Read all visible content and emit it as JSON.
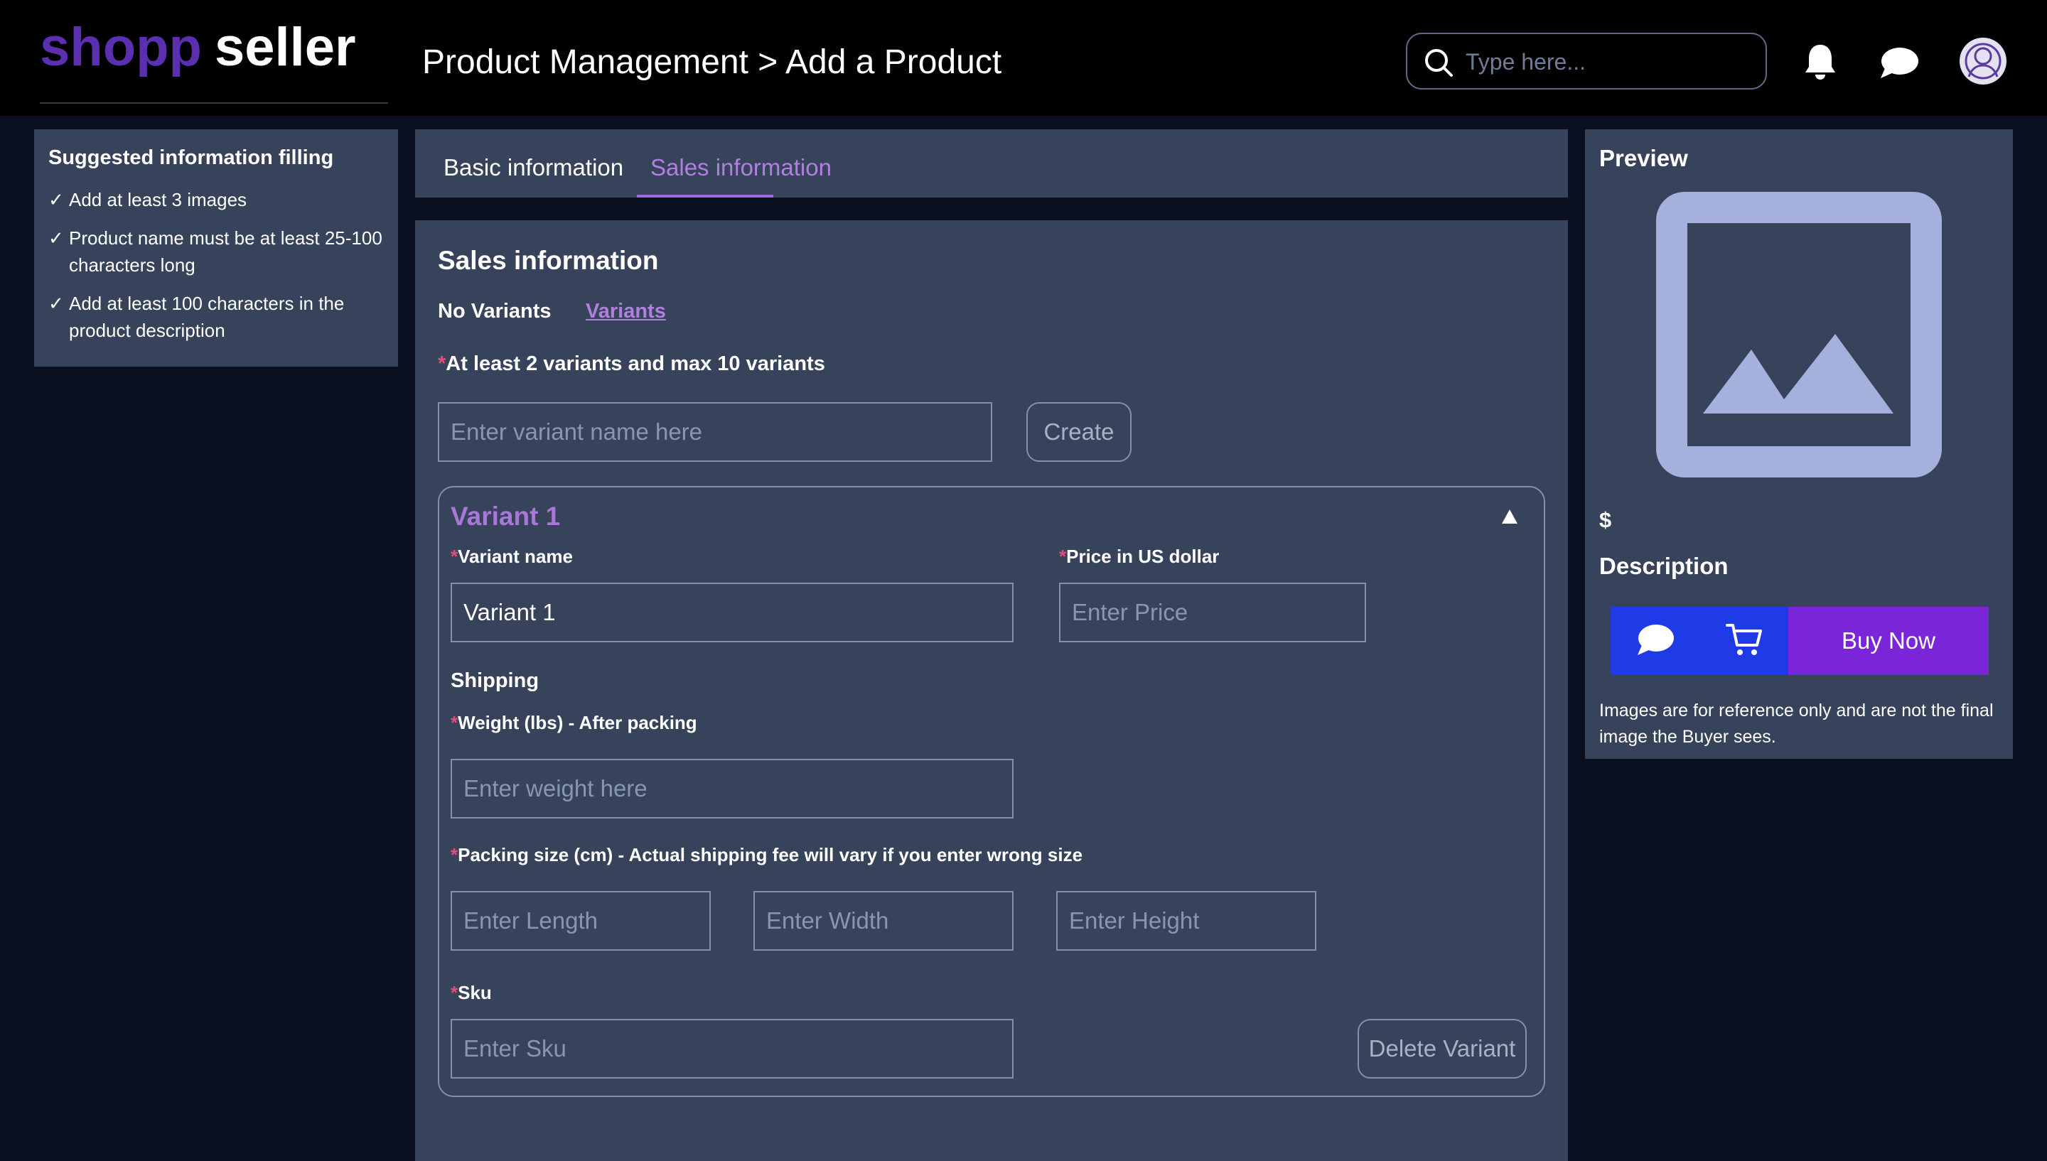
{
  "brand": {
    "part1": "shopp",
    "part2": "seller"
  },
  "header": {
    "title": "Product Management > Add a Product",
    "search_placeholder": "Type here..."
  },
  "suggestions": {
    "title": "Suggested information filling",
    "items": [
      "Add at least 3 images",
      "Product name must be at least 25-100 characters long",
      "Add at least 100 characters in the product description"
    ]
  },
  "tabs": [
    {
      "label": "Basic information",
      "active": false
    },
    {
      "label": "Sales information",
      "active": true
    }
  ],
  "sales": {
    "title": "Sales information",
    "no_variants_label": "No Variants",
    "variants_label": "Variants",
    "rule_note": "At least 2 variants and max 10 variants",
    "variant_name_placeholder": "Enter variant name here",
    "create_label": "Create"
  },
  "variant": {
    "title": "Variant 1",
    "name_label": "Variant name",
    "name_value": "Variant 1",
    "price_label": "Price in US dollar",
    "price_placeholder": "Enter Price",
    "shipping_label": "Shipping",
    "weight_label": "Weight (lbs) - After packing",
    "weight_placeholder": "Enter weight here",
    "packing_label": "Packing size (cm) - Actual shipping fee will vary if you enter wrong size",
    "length_placeholder": "Enter Length",
    "width_placeholder": "Enter Width",
    "height_placeholder": "Enter Height",
    "sku_label": "Sku",
    "sku_placeholder": "Enter Sku",
    "delete_label": "Delete Variant",
    "required_mark": "*",
    "expanded": true
  },
  "preview": {
    "title": "Preview",
    "price_symbol": "$",
    "description_label": "Description",
    "buy_label": "Buy Now",
    "disclaimer": "Images are for reference only and are not the final image the Buyer sees.",
    "icons": [
      "image-placeholder-icon",
      "chat-icon",
      "cart-icon"
    ]
  },
  "colors": {
    "brand_purple": "#5b2fb0",
    "accent_purple": "#b27fe0",
    "panel": "#36435a",
    "background": "#0b1021",
    "buy_button": "#7a26d8",
    "action_blue": "#1f3be8",
    "image_placeholder": "#a6b0dc"
  }
}
